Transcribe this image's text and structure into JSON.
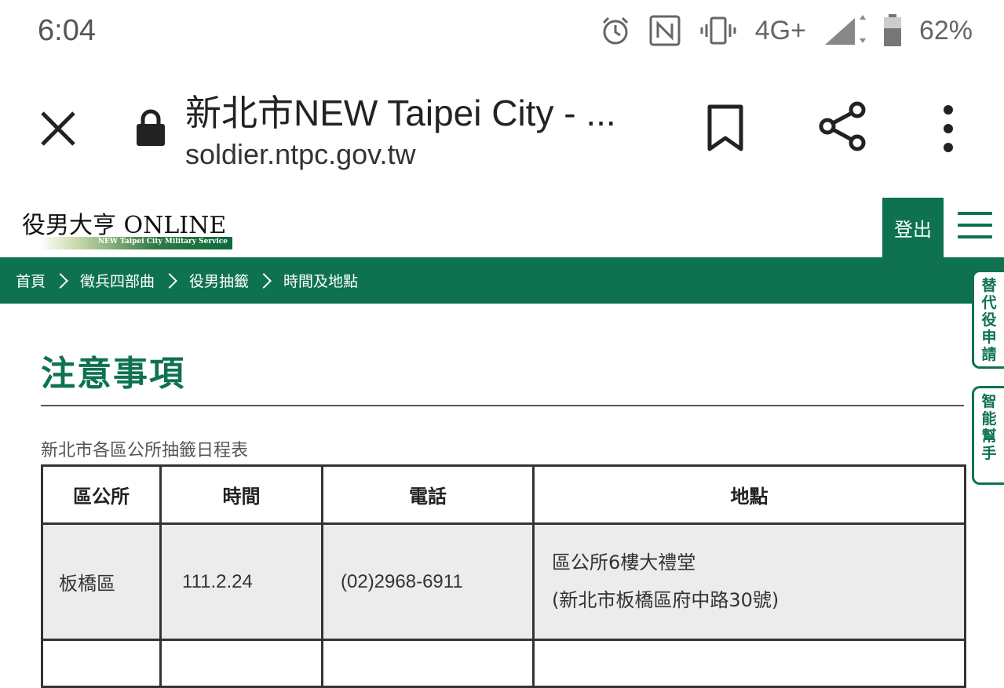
{
  "status_bar": {
    "time": "6:04",
    "network": "4G+",
    "battery": "62%",
    "icons": [
      "alarm-icon",
      "nfc-icon",
      "vibrate-icon",
      "signal-icon",
      "battery-icon"
    ]
  },
  "browser": {
    "title": "新北市NEW Taipei City - ...",
    "url": "soldier.ntpc.gov.tw"
  },
  "site": {
    "logo_main": "役男大亨 ONLINE",
    "logo_sub": "NEW Taipei City Military Service",
    "logout_label": "登出",
    "accent_color": "#0e7250"
  },
  "breadcrumb": [
    "首頁",
    "徵兵四部曲",
    "役男抽籤",
    "時間及地點"
  ],
  "side_tabs": {
    "substitute": [
      "替",
      "代",
      "役",
      "申",
      "請"
    ],
    "assistant": [
      "智",
      "能",
      "幫",
      "手"
    ]
  },
  "content": {
    "title": "注意事項",
    "caption": "新北市各區公所抽籤日程表",
    "table": {
      "headers": [
        "區公所",
        "時間",
        "電話",
        "地點"
      ],
      "rows": [
        {
          "district": "板橋區",
          "time": "111.2.24",
          "phone": "(02)2968-6911",
          "location_line1": "區公所6樓大禮堂",
          "location_line2": "(新北市板橋區府中路30號)"
        }
      ]
    }
  }
}
